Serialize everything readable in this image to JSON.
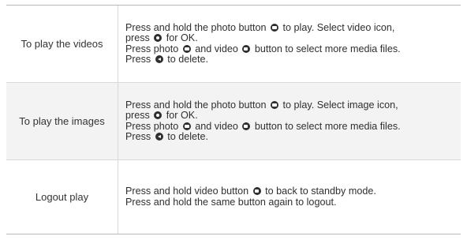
{
  "rows": [
    {
      "label": "To play the videos",
      "l1a": "Press and hold the photo button",
      "l1b": "to play. Select video icon,",
      "l2a": "press",
      "l2b": "for OK.",
      "l3a": "Press photo",
      "l3b": "and video",
      "l3c": "button to select more media files.",
      "l4a": "Press",
      "l4b": "to delete."
    },
    {
      "label": "To play the images",
      "l1a": "Press and hold the photo button",
      "l1b": "to play. Select image icon,",
      "l2a": "press",
      "l2b": "for OK.",
      "l3a": "Press photo",
      "l3b": "and video",
      "l3c": "button to select more media files.",
      "l4a": "Press",
      "l4b": "to delete."
    },
    {
      "label": "Logout play",
      "l1a": "Press and hold video button",
      "l1b": "to back to standby mode.",
      "l2": "Press and hold the same button again to logout."
    }
  ],
  "icons": {
    "photo": "photo-button-icon",
    "video": "video-button-icon",
    "ok": "ok-button-icon",
    "delete": "delete-button-icon"
  }
}
